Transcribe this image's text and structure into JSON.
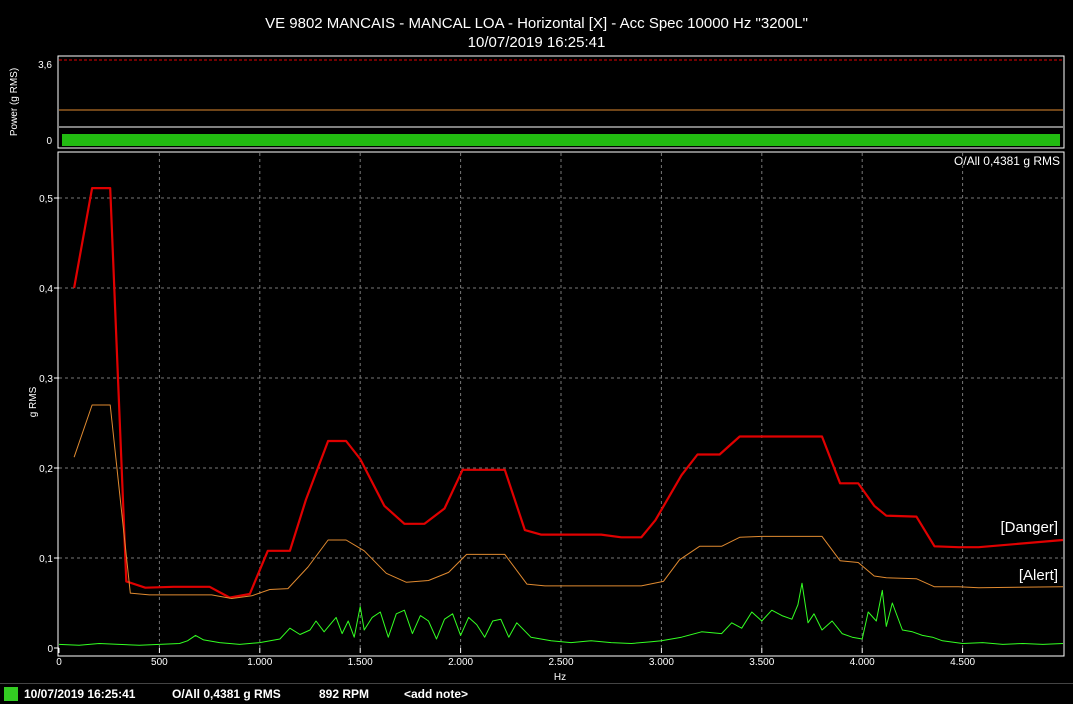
{
  "title": {
    "line1": "VE 9802 MANCAIS - MANCAL LOA - Horizontal [X] - Acc Spec 10000 Hz \"3200L\"",
    "line2": "10/07/2019 16:25:41"
  },
  "power_panel": {
    "ylabel": "Power (g RMS)",
    "yticks": [
      "3,6",
      "0"
    ],
    "ylim": [
      0,
      3.6
    ],
    "danger_level": 3.6,
    "alert_level": 1.35,
    "bar_value": 0.4381
  },
  "overall_label": "O/All 0,4381 g RMS",
  "limit_labels": {
    "danger": "[Danger]",
    "alert": "[Alert]"
  },
  "footer": {
    "date": "10/07/2019 16:25:41",
    "overall": "O/All 0,4381 g RMS",
    "rpm": "892 RPM",
    "note": "<add note>"
  },
  "colors": {
    "danger": "#e00000",
    "alert": "#e08a30",
    "spectrum": "#33ff22",
    "grid": "#777777",
    "bar": "#22bb11"
  },
  "chart_data": {
    "type": "line",
    "xlabel": "Hz",
    "ylabel": "g RMS",
    "xlim": [
      0,
      5000
    ],
    "ylim": [
      0,
      0.55
    ],
    "xticks": [
      0,
      500,
      1000,
      1500,
      2000,
      2500,
      3000,
      3500,
      4000,
      4500
    ],
    "xtick_labels": [
      "0",
      "500",
      "1.000",
      "1.500",
      "2.000",
      "2.500",
      "3.000",
      "3.500",
      "4.000",
      "4.500"
    ],
    "yticks": [
      0,
      0.1,
      0.2,
      0.3,
      0.4,
      0.5
    ],
    "ytick_labels": [
      "0",
      "0,1",
      "0,2",
      "0,3",
      "0,4",
      "0,5"
    ],
    "grid": true,
    "series": [
      {
        "name": "Danger",
        "x": [
          75,
          165,
          255,
          335,
          430,
          570,
          750,
          850,
          950,
          1040,
          1150,
          1230,
          1340,
          1430,
          1500,
          1620,
          1720,
          1820,
          1920,
          2010,
          2220,
          2320,
          2400,
          2700,
          2800,
          2900,
          2970,
          3100,
          3180,
          3290,
          3390,
          3500,
          3800,
          3890,
          3980,
          4060,
          4120,
          4270,
          4360,
          4480,
          4580,
          5000
        ],
        "y": [
          0.4,
          0.511,
          0.511,
          0.074,
          0.067,
          0.068,
          0.068,
          0.056,
          0.06,
          0.108,
          0.108,
          0.165,
          0.23,
          0.23,
          0.21,
          0.158,
          0.138,
          0.138,
          0.155,
          0.198,
          0.198,
          0.131,
          0.126,
          0.126,
          0.123,
          0.123,
          0.142,
          0.192,
          0.215,
          0.215,
          0.235,
          0.235,
          0.235,
          0.183,
          0.183,
          0.158,
          0.147,
          0.146,
          0.113,
          0.112,
          0.112,
          0.12
        ]
      },
      {
        "name": "Alert",
        "x": [
          75,
          165,
          255,
          355,
          450,
          590,
          760,
          860,
          960,
          1050,
          1140,
          1240,
          1340,
          1430,
          1520,
          1630,
          1730,
          1840,
          1940,
          2030,
          2220,
          2330,
          2420,
          2800,
          2900,
          3010,
          3090,
          3190,
          3300,
          3390,
          3500,
          3800,
          3890,
          3980,
          4060,
          4120,
          4270,
          4360,
          4480,
          4580,
          5000
        ],
        "y": [
          0.212,
          0.27,
          0.27,
          0.061,
          0.059,
          0.059,
          0.059,
          0.055,
          0.058,
          0.065,
          0.066,
          0.09,
          0.12,
          0.12,
          0.108,
          0.083,
          0.073,
          0.075,
          0.084,
          0.104,
          0.104,
          0.071,
          0.069,
          0.069,
          0.069,
          0.074,
          0.098,
          0.113,
          0.113,
          0.123,
          0.124,
          0.124,
          0.097,
          0.095,
          0.08,
          0.078,
          0.077,
          0.068,
          0.068,
          0.067,
          0.068
        ]
      },
      {
        "name": "Spectrum",
        "x": [
          0,
          100,
          200,
          300,
          400,
          500,
          600,
          640,
          680,
          720,
          800,
          900,
          1000,
          1100,
          1150,
          1200,
          1250,
          1280,
          1320,
          1350,
          1380,
          1410,
          1440,
          1470,
          1500,
          1520,
          1560,
          1600,
          1640,
          1680,
          1720,
          1760,
          1800,
          1840,
          1880,
          1920,
          1960,
          2000,
          2040,
          2080,
          2120,
          2160,
          2200,
          2240,
          2280,
          2350,
          2450,
          2550,
          2650,
          2750,
          2850,
          2950,
          3000,
          3100,
          3200,
          3300,
          3350,
          3400,
          3450,
          3500,
          3550,
          3600,
          3650,
          3680,
          3700,
          3730,
          3760,
          3800,
          3850,
          3900,
          3950,
          4000,
          4030,
          4070,
          4100,
          4120,
          4150,
          4200,
          4250,
          4300,
          4350,
          4400,
          4500,
          4600,
          4700,
          4800,
          4900,
          5000
        ],
        "y": [
          0.004,
          0.003,
          0.005,
          0.004,
          0.003,
          0.004,
          0.005,
          0.008,
          0.014,
          0.009,
          0.006,
          0.004,
          0.006,
          0.01,
          0.022,
          0.015,
          0.02,
          0.03,
          0.018,
          0.026,
          0.034,
          0.016,
          0.03,
          0.012,
          0.046,
          0.02,
          0.034,
          0.04,
          0.012,
          0.038,
          0.042,
          0.016,
          0.036,
          0.03,
          0.01,
          0.032,
          0.038,
          0.014,
          0.034,
          0.026,
          0.012,
          0.03,
          0.032,
          0.012,
          0.028,
          0.012,
          0.008,
          0.006,
          0.008,
          0.006,
          0.005,
          0.007,
          0.008,
          0.012,
          0.018,
          0.016,
          0.028,
          0.022,
          0.04,
          0.03,
          0.042,
          0.036,
          0.032,
          0.048,
          0.072,
          0.028,
          0.038,
          0.02,
          0.03,
          0.016,
          0.012,
          0.01,
          0.04,
          0.03,
          0.064,
          0.024,
          0.05,
          0.02,
          0.018,
          0.014,
          0.012,
          0.008,
          0.005,
          0.006,
          0.004,
          0.005,
          0.004,
          0.005
        ]
      }
    ]
  }
}
